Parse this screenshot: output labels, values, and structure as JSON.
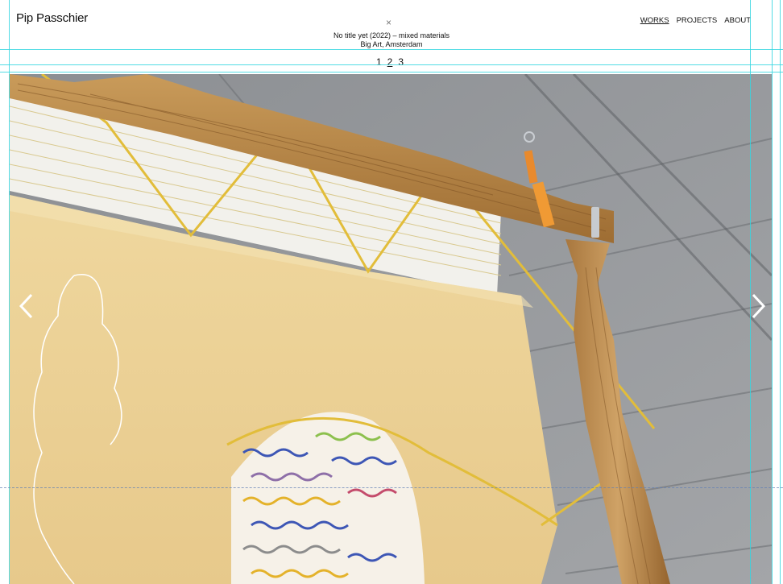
{
  "site": {
    "title": "Pip Passchier"
  },
  "nav": {
    "items": [
      {
        "label": "WORKS",
        "active": true
      },
      {
        "label": "PROJECTS",
        "active": false
      },
      {
        "label": "ABOUT",
        "active": false
      }
    ]
  },
  "caption": {
    "close_icon": "×",
    "line1": "No title yet (2022) – mixed materials",
    "line2": "Big Art, Amsterdam"
  },
  "pager": {
    "pages": [
      "1",
      "2",
      "3"
    ],
    "current": "2"
  },
  "slideshow": {
    "prev_icon": "chevron-left-icon",
    "next_icon": "chevron-right-icon"
  },
  "colors": {
    "accent_guides": "#35d6e0",
    "text": "#111111",
    "background": "#ffffff"
  }
}
